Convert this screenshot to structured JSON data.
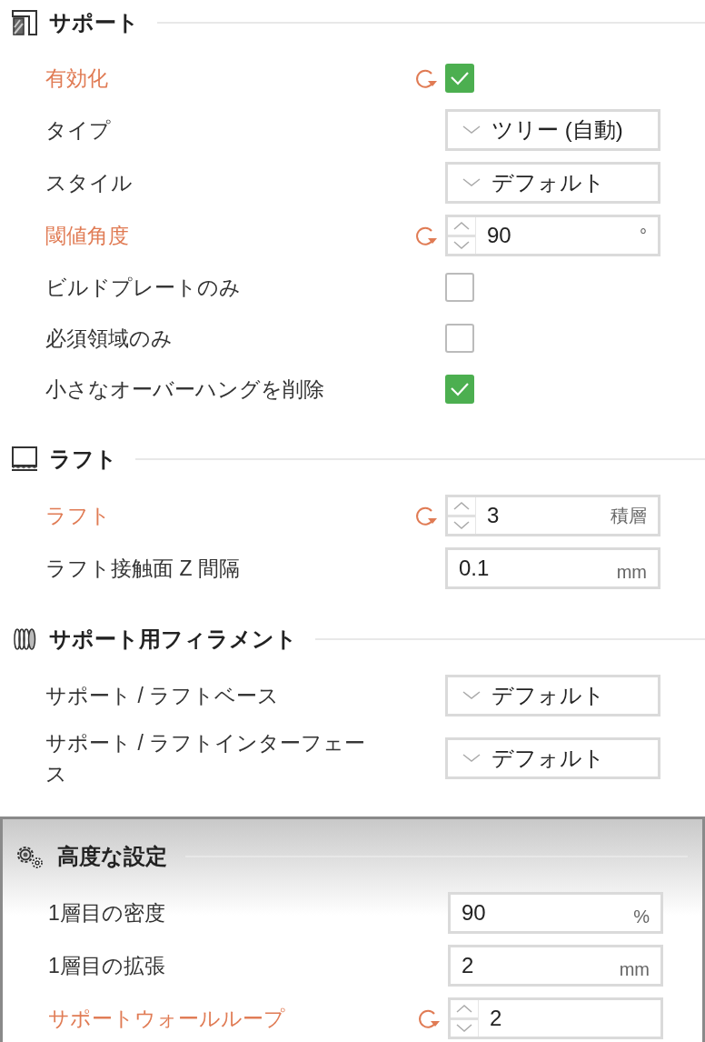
{
  "sections": [
    {
      "title": "サポート",
      "kind": "support",
      "highlighted": false,
      "rows": [
        {
          "label": "有効化",
          "kind": "checkbox",
          "modified": true,
          "checked": true
        },
        {
          "label": "タイプ",
          "kind": "select",
          "modified": false,
          "value": "ツリー (自動)"
        },
        {
          "label": "スタイル",
          "kind": "select",
          "modified": false,
          "value": "デフォルト"
        },
        {
          "label": "閾値角度",
          "kind": "spin",
          "modified": true,
          "value": "90",
          "unit": "°"
        },
        {
          "label": "ビルドプレートのみ",
          "kind": "checkbox",
          "modified": false,
          "checked": false
        },
        {
          "label": "必須領域のみ",
          "kind": "checkbox",
          "modified": false,
          "checked": false
        },
        {
          "label": "小さなオーバーハングを削除",
          "kind": "checkbox",
          "modified": false,
          "checked": true
        }
      ]
    },
    {
      "title": "ラフト",
      "kind": "raft",
      "highlighted": false,
      "rows": [
        {
          "label": "ラフト",
          "kind": "spin",
          "modified": true,
          "value": "3",
          "unit": "積層"
        },
        {
          "label": "ラフト接触面 Z 間隔",
          "kind": "number",
          "modified": false,
          "value": "0.1",
          "unit": "mm"
        }
      ]
    },
    {
      "title": "サポート用フィラメント",
      "kind": "filament",
      "highlighted": false,
      "rows": [
        {
          "label": "サポート / ラフトベース",
          "kind": "select",
          "modified": false,
          "value": "デフォルト"
        },
        {
          "label": "サポート / ラフトインターフェース",
          "kind": "select",
          "modified": false,
          "value": "デフォルト"
        }
      ]
    },
    {
      "title": "高度な設定",
      "kind": "gear",
      "highlighted": true,
      "rows": [
        {
          "label": "1層目の密度",
          "kind": "number",
          "modified": false,
          "value": "90",
          "unit": "%"
        },
        {
          "label": "1層目の拡張",
          "kind": "number",
          "modified": false,
          "value": "2",
          "unit": "mm"
        },
        {
          "label": "サポートウォールループ",
          "kind": "spin",
          "modified": true,
          "value": "2"
        }
      ]
    }
  ]
}
